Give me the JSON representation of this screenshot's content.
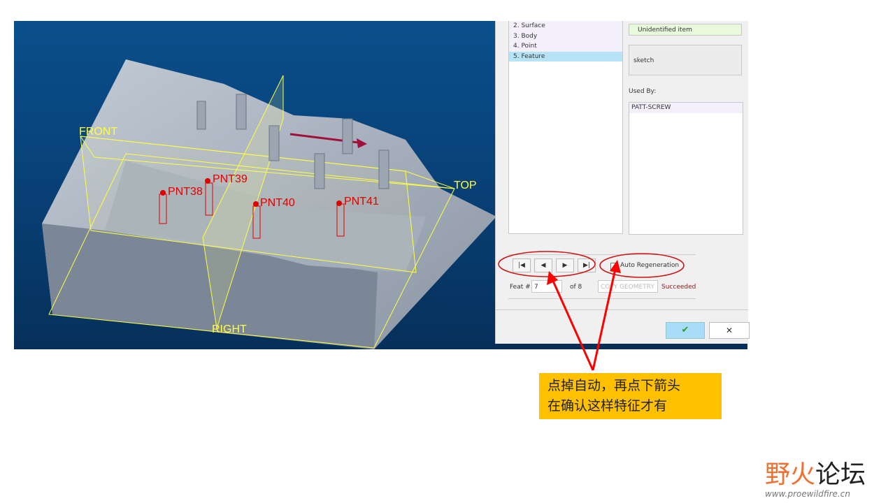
{
  "viewport": {
    "datum_planes": [
      "FRONT",
      "TOP",
      "RIGHT"
    ],
    "points": [
      "PNT38",
      "PNT39",
      "PNT40",
      "PNT41"
    ]
  },
  "dialog": {
    "list_items": [
      {
        "label": "2. Surface",
        "selected": false
      },
      {
        "label": "3. Body",
        "selected": false
      },
      {
        "label": "4. Point",
        "selected": false
      },
      {
        "label": "5. Feature",
        "selected": true
      }
    ],
    "status_field": "Unidentified item",
    "info_field": "sketch",
    "used_by_label": "Used By:",
    "used_by_items": [
      "PATT-SCREW"
    ],
    "nav_buttons": [
      {
        "icon": "first-icon",
        "glyph": "|◀"
      },
      {
        "icon": "prev-icon",
        "glyph": "◀"
      },
      {
        "icon": "next-icon",
        "glyph": "▶"
      },
      {
        "icon": "last-icon",
        "glyph": "▶|"
      }
    ],
    "auto_regeneration": {
      "label": "Auto Regeneration",
      "checked": false
    },
    "feat_label": "Feat #",
    "feat_value": "7",
    "of_label": "of 8",
    "feature_type": "COPY GEOMETRY",
    "status": "Succeeded",
    "ok_glyph": "✔",
    "cancel_glyph": "✕"
  },
  "callout": {
    "line1": "点掉自动，再点下箭头",
    "line2": "在确认这样特征才有"
  },
  "logo": {
    "text_a": "野火",
    "text_b": "论坛",
    "url": "www.proewildfire.cn"
  },
  "colors": {
    "accent_red": "#e00000",
    "callout_bg": "#ffc000",
    "datum": "#ffff40"
  }
}
